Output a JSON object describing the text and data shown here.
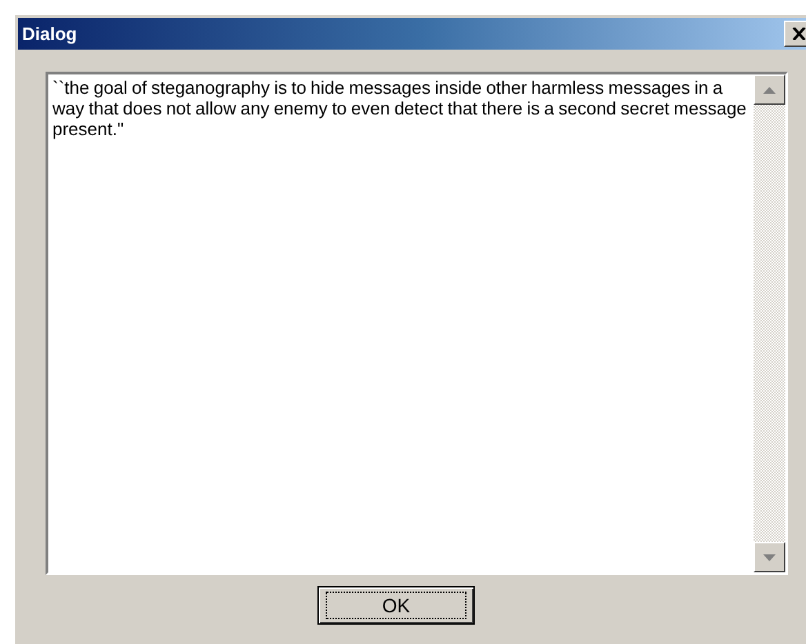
{
  "window": {
    "title": "Dialog"
  },
  "text_area": {
    "value": "``the goal of steganography is to hide messages inside other harmless messages in a way that does not allow any enemy to even detect that there is a second secret message present.\""
  },
  "buttons": [
    {
      "label": "OK",
      "focused": true
    }
  ]
}
